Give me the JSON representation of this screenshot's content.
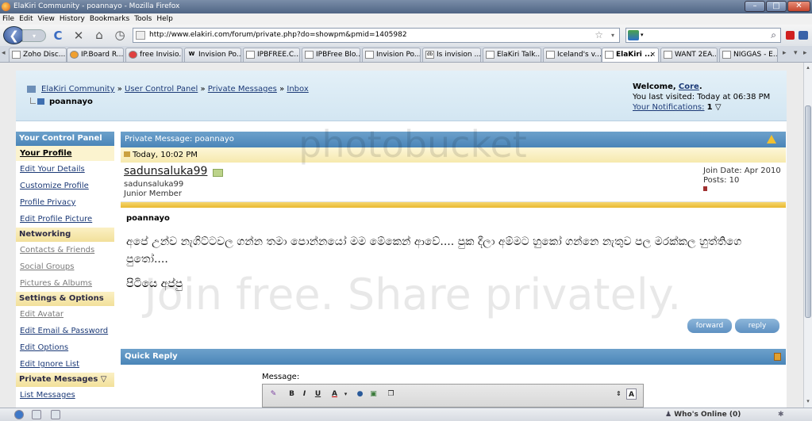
{
  "window": {
    "title": "ElaKiri Community - poannayo - Mozilla Firefox",
    "controls": [
      "–",
      "□",
      "✕"
    ]
  },
  "menu": [
    "File",
    "Edit",
    "View",
    "History",
    "Bookmarks",
    "Tools",
    "Help"
  ],
  "nav": {
    "url": "http://www.elakiri.com/forum/private.php?do=showpm&pmid=1405982",
    "search_value": "",
    "icons": {
      "back": "❮",
      "forward": "▾",
      "reload": "C",
      "stop": "✕",
      "home": "⌂",
      "history": "◷",
      "star": "☆",
      "search": "⌕"
    }
  },
  "tabs": [
    "Zoho Disc...",
    "IP.Board R...",
    "free Invisio...",
    "Invision Po...",
    "IPBFREE.C...",
    "IPBFree Blo...",
    "Invision Po...",
    "Is invision ...",
    "ElaKiri Talk...",
    "Iceland's v...",
    "ElaKiri ...",
    "WANT 2EA...",
    "NIGGAS - E..."
  ],
  "tab_close": "×",
  "breadcrumb": {
    "items": [
      "ElaKiri Community",
      "User Control Panel",
      "Private Messages",
      "Inbox"
    ],
    "sep": "»",
    "current": "poannayo"
  },
  "welcome": {
    "prefix": "Welcome,",
    "user": "Core",
    "punct": ".",
    "last_visit": "You last visited: Today at 06:38 PM",
    "notifications_label": "Your Notifications:",
    "notifications_count": "1",
    "caret": "▽"
  },
  "sidebar": {
    "title": "Your Control Panel",
    "your_profile": "Your Profile",
    "profile_items": [
      "Edit Your Details",
      "Customize Profile",
      "Profile Privacy",
      "Edit Profile Picture"
    ],
    "networking": "Networking",
    "net_items": [
      "Contacts & Friends",
      "Social Groups",
      "Pictures & Albums"
    ],
    "settings": "Settings & Options",
    "set_items": [
      "Edit Avatar",
      "Edit Email & Password",
      "Edit Options",
      "Edit Ignore List"
    ],
    "pms": "Private Messages ▽",
    "pm_items": [
      "List Messages"
    ]
  },
  "pm": {
    "header": "Private Message: poannayo",
    "date": "Today, 10:02 PM",
    "author": "sadunsaluka99",
    "author_sub": "sadunsaluka99",
    "rank": "Junior Member",
    "join_date": "Join Date: Apr 2010",
    "posts": "Posts: 10",
    "title": "poannayo",
    "text": "අපේ උන්ව නැගිට්ටවල ගන්න තමා පොන්නයෝ මම මේකෙන් ආවේ.... පුක දීලා අම්මට හුකෝ ගන්නෙ නැතුව පල මරක්කල හුත්තිගෙ පුතෝ....",
    "signature": "පිටියෙ අප්පු",
    "forward": "forward",
    "reply": "reply"
  },
  "quick_reply": {
    "header": "Quick Reply",
    "message_label": "Message:",
    "toolbar": [
      "B",
      "I",
      "U",
      "A"
    ]
  },
  "status": {
    "whos_online": "Who's Online (0)",
    "icon": "✱"
  },
  "watermark": {
    "logo": "photobucket",
    "tagline": "Join free. Share privately."
  }
}
